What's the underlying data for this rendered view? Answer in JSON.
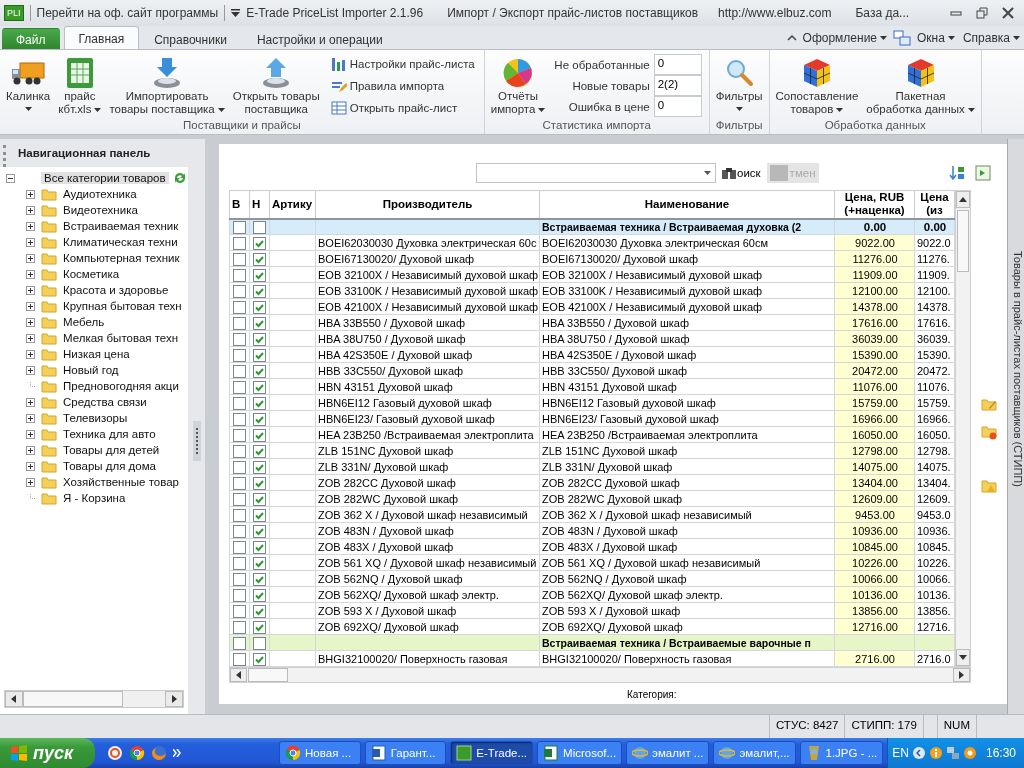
{
  "title_bar": {
    "app_badge": "PLI",
    "site_link": "Перейти на оф. сайт программы",
    "app_name": "E-Trade PriceList Importer 2.1.96",
    "subtitle": "Импорт / Экспорт прайс-листов поставщиков",
    "url": "http://www.elbuz.com",
    "database": "База да..."
  },
  "ribbon_tabs": [
    {
      "label": "Файл",
      "kind": "file",
      "selected": false
    },
    {
      "label": "Главная",
      "kind": "tab",
      "selected": true
    },
    {
      "label": "Справочники",
      "kind": "tab",
      "selected": false
    },
    {
      "label": "Настройки и операции",
      "kind": "tab",
      "selected": false
    }
  ],
  "ribbon_menus": [
    {
      "label": "Оформление"
    },
    {
      "label": "Окна"
    },
    {
      "label": "Справка"
    }
  ],
  "ribbon_groups": [
    {
      "title": "Поставщики и прайсы",
      "items": [
        {
          "kind": "large",
          "lines": [
            "Калинка"
          ],
          "dropdown": true
        },
        {
          "kind": "large",
          "lines": [
            "прайс",
            "кбт.xls"
          ],
          "dropdown": true
        },
        {
          "kind": "large",
          "lines": [
            "Импортировать",
            "товары поставщика"
          ],
          "dropdown": true
        },
        {
          "kind": "large",
          "lines": [
            "Открыть товары",
            "поставщика"
          ],
          "dropdown": false
        },
        {
          "kind": "small",
          "label": "Настройки прайс-листа"
        },
        {
          "kind": "small",
          "label": "Правила импорта"
        },
        {
          "kind": "small",
          "label": "Открыть прайс-лист"
        }
      ]
    },
    {
      "title": "Статистика импорта",
      "items": [
        {
          "kind": "large",
          "lines": [
            "Отчёты",
            "импорта"
          ],
          "dropdown": true
        },
        {
          "kind": "stat",
          "label": "Не обработанные",
          "value": "0"
        },
        {
          "kind": "stat",
          "label": "Новые товары",
          "value": "2(2)"
        },
        {
          "kind": "stat",
          "label": "Ошибка в цене",
          "value": "0"
        }
      ]
    },
    {
      "title": "Фильтры",
      "items": [
        {
          "kind": "large",
          "lines": [
            "Фильтры"
          ],
          "dropdown": true
        }
      ]
    },
    {
      "title": "Обработка данных",
      "items": [
        {
          "kind": "large",
          "lines": [
            "Сопоставление",
            "товаров"
          ],
          "dropdown": true
        },
        {
          "kind": "large",
          "lines": [
            "Пакетная",
            "обработка данных"
          ],
          "dropdown": true
        }
      ]
    }
  ],
  "nav_panel": {
    "title": "Навигационная панель",
    "tree": [
      {
        "label": "Все категории товаров",
        "kind": "folder",
        "expanded": true,
        "selected": true,
        "children": [
          {
            "label": "Аудиотехника",
            "kind": "folder",
            "expanded": false,
            "selected": false
          },
          {
            "label": "Видеотехника",
            "kind": "folder",
            "expanded": false,
            "selected": false
          },
          {
            "label": "Встраиваемая техник",
            "kind": "folder",
            "expanded": false,
            "selected": false
          },
          {
            "label": "Климатическая техни",
            "kind": "folder",
            "expanded": false,
            "selected": false
          },
          {
            "label": "Компьютерная техник",
            "kind": "folder",
            "expanded": false,
            "selected": false
          },
          {
            "label": "Косметика",
            "kind": "folder",
            "expanded": false,
            "selected": false
          },
          {
            "label": "Красота и здоровье",
            "kind": "folder",
            "expanded": false,
            "selected": false
          },
          {
            "label": "Крупная бытовая техн",
            "kind": "folder",
            "expanded": false,
            "selected": false
          },
          {
            "label": "Мебель",
            "kind": "folder",
            "expanded": false,
            "selected": false
          },
          {
            "label": "Мелкая бытовая техн",
            "kind": "folder",
            "expanded": false,
            "selected": false
          },
          {
            "label": "Низкая цена",
            "kind": "folder",
            "expanded": false,
            "selected": false
          },
          {
            "label": "Новый год",
            "kind": "folder",
            "expanded": false,
            "selected": false
          },
          {
            "label": "Предновогодняя акци",
            "kind": "leaf",
            "selected": false
          },
          {
            "label": "Средства связи",
            "kind": "folder",
            "expanded": false,
            "selected": false
          },
          {
            "label": "Телевизоры",
            "kind": "folder",
            "expanded": false,
            "selected": false
          },
          {
            "label": "Техника для авто",
            "kind": "folder",
            "expanded": false,
            "selected": false
          },
          {
            "label": "Товары для детей",
            "kind": "folder",
            "expanded": false,
            "selected": false
          },
          {
            "label": "Товары для дома",
            "kind": "folder",
            "expanded": false,
            "selected": false
          },
          {
            "label": "Хозяйственные товар",
            "kind": "folder",
            "expanded": false,
            "selected": false
          },
          {
            "label": "Я - Корзина",
            "kind": "leaf",
            "selected": false
          }
        ]
      }
    ]
  },
  "grid": {
    "search_button": "оиск",
    "cancel_button": {
      "label": "тмен",
      "disabled": true
    },
    "columns": [
      "В",
      "Н",
      "Артику",
      "Производитель",
      "Наименование",
      "Цена, RUB (+наценка)",
      "Цена (из"
    ],
    "rows": [
      {
        "kind": "group",
        "b": false,
        "h": false,
        "title": "Встраиваемая техника / Встраиваемая духовка (2",
        "price": "0.00",
        "price_src": "0.00",
        "color": "#d7ecfb"
      },
      {
        "kind": "item",
        "b": false,
        "h": true,
        "maker": "BOEI62030030 Духовка электрическая 60с",
        "name": "BOEI62030030 Духовка электрическая 60см",
        "price": "9022.00",
        "price_src": "9022.0"
      },
      {
        "kind": "item",
        "b": false,
        "h": true,
        "maker": "BOEI67130020/ Духовой шкаф",
        "name": "BOEI67130020/ Духовой шкаф",
        "price": "11276.00",
        "price_src": "11276."
      },
      {
        "kind": "item",
        "b": false,
        "h": true,
        "maker": "EOB 32100X / Независимый духовой шкаф",
        "name": "EOB 32100X / Независимый духовой шкаф",
        "price": "11909.00",
        "price_src": "11909."
      },
      {
        "kind": "item",
        "b": false,
        "h": true,
        "maker": "EOB 33100K / Независимый духовой шкаф",
        "name": "EOB 33100K / Независимый духовой шкаф",
        "price": "12100.00",
        "price_src": "12100."
      },
      {
        "kind": "item",
        "b": false,
        "h": true,
        "maker": "EOB 42100X / Независимый духовой шкаф",
        "name": "EOB 42100X / Независимый духовой шкаф",
        "price": "14378.00",
        "price_src": "14378."
      },
      {
        "kind": "item",
        "b": false,
        "h": true,
        "maker": "HBA 33B550 / Духовой шкаф",
        "name": "HBA 33B550 / Духовой шкаф",
        "price": "17616.00",
        "price_src": "17616."
      },
      {
        "kind": "item",
        "b": false,
        "h": true,
        "maker": "HBA 38U750 / Духовой шкаф",
        "name": "HBA 38U750 / Духовой шкаф",
        "price": "36039.00",
        "price_src": "36039."
      },
      {
        "kind": "item",
        "b": false,
        "h": true,
        "maker": "HBA 42S350E / Духовой шкаф",
        "name": "HBA 42S350E / Духовой шкаф",
        "price": "15390.00",
        "price_src": "15390."
      },
      {
        "kind": "item",
        "b": false,
        "h": true,
        "maker": "HBB 33C550/ Духовой шкаф",
        "name": "HBB 33C550/ Духовой шкаф",
        "price": "20472.00",
        "price_src": "20472."
      },
      {
        "kind": "item",
        "b": false,
        "h": true,
        "maker": "HBN 43151 Духовой шкаф",
        "name": "HBN 43151 Духовой шкаф",
        "price": "11076.00",
        "price_src": "11076."
      },
      {
        "kind": "item",
        "b": false,
        "h": true,
        "maker": "HBN6EI12 Газовый духовой шкаф",
        "name": "HBN6EI12 Газовый духовой шкаф",
        "price": "15759.00",
        "price_src": "15759."
      },
      {
        "kind": "item",
        "b": false,
        "h": true,
        "maker": "HBN6EI23/ Газовый духовой шкаф",
        "name": "HBN6EI23/ Газовый духовой шкаф",
        "price": "16966.00",
        "price_src": "16966."
      },
      {
        "kind": "item",
        "b": false,
        "h": true,
        "maker": "HEA 23B250 /Встраиваемая электроплита",
        "name": "HEA 23B250 /Встраиваемая электроплита",
        "price": "16050.00",
        "price_src": "16050."
      },
      {
        "kind": "item",
        "b": false,
        "h": true,
        "maker": "ZLB 151NC  Духовой шкаф",
        "name": "ZLB 151NC  Духовой шкаф",
        "price": "12798.00",
        "price_src": "12798."
      },
      {
        "kind": "item",
        "b": false,
        "h": true,
        "maker": "ZLB 331N/ Духовой шкаф",
        "name": "ZLB 331N/ Духовой шкаф",
        "price": "14075.00",
        "price_src": "14075."
      },
      {
        "kind": "item",
        "b": false,
        "h": true,
        "maker": "ZOB 282CC Духовой шкаф",
        "name": "ZOB 282CC Духовой шкаф",
        "price": "13404.00",
        "price_src": "13404."
      },
      {
        "kind": "item",
        "b": false,
        "h": true,
        "maker": "ZOB 282WC Духовой шкаф",
        "name": "ZOB 282WC Духовой шкаф",
        "price": "12609.00",
        "price_src": "12609."
      },
      {
        "kind": "item",
        "b": false,
        "h": true,
        "maker": "ZOB 362 X / Духовой шкаф независимый",
        "name": "ZOB 362 X / Духовой шкаф независимый",
        "price": "9453.00",
        "price_src": "9453.0"
      },
      {
        "kind": "item",
        "b": false,
        "h": true,
        "maker": "ZOB 483N / Духовой шкаф",
        "name": "ZOB 483N / Духовой шкаф",
        "price": "10936.00",
        "price_src": "10936."
      },
      {
        "kind": "item",
        "b": false,
        "h": true,
        "maker": "ZOB 483X / Духовой шкаф",
        "name": "ZOB 483X / Духовой шкаф",
        "price": "10845.00",
        "price_src": "10845."
      },
      {
        "kind": "item",
        "b": false,
        "h": true,
        "maker": "ZOB 561 XQ / Духовой шкаф независимый",
        "name": "ZOB 561 XQ / Духовой шкаф независимый",
        "price": "10226.00",
        "price_src": "10226."
      },
      {
        "kind": "item",
        "b": false,
        "h": true,
        "maker": "ZOB 562NQ / Духовой шкаф",
        "name": "ZOB 562NQ / Духовой шкаф",
        "price": "10066.00",
        "price_src": "10066."
      },
      {
        "kind": "item",
        "b": false,
        "h": true,
        "maker": "ZOB 562XQ/ Духовой шкаф электр.",
        "name": "ZOB 562XQ/ Духовой шкаф электр.",
        "price": "10136.00",
        "price_src": "10136."
      },
      {
        "kind": "item",
        "b": false,
        "h": true,
        "maker": "ZOB 593 X / Духовой шкаф",
        "name": "ZOB 593 X / Духовой шкаф",
        "price": "13856.00",
        "price_src": "13856."
      },
      {
        "kind": "item",
        "b": false,
        "h": true,
        "maker": "ZOB 692XQ/ Духовой шкаф",
        "name": "ZOB 692XQ/ Духовой шкаф",
        "price": "12716.00",
        "price_src": "12716."
      },
      {
        "kind": "group",
        "b": false,
        "h": false,
        "title": "Встраиваемая техника / Встраиваемые варочные п",
        "color": "#e6f6c9"
      },
      {
        "kind": "item",
        "b": false,
        "h": true,
        "maker": "BHGI32100020/ Поверхность газовая",
        "name": "BHGI32100020/ Поверхность газовая",
        "price": "2716.00",
        "price_src": "2716.0"
      }
    ],
    "footer": "Категория:"
  },
  "side_tab": "Товары в прайс-листах поставщиков (СТИПП)",
  "status_bar": [
    "СТУС: 8427",
    "СТИПП: 179",
    "NUM"
  ],
  "taskbar": {
    "start": "пуск",
    "tasks": [
      {
        "label": "Новая ...",
        "selected": false
      },
      {
        "label": "Гарант...",
        "selected": false
      },
      {
        "label": "E-Trade...",
        "selected": true
      },
      {
        "label": "Microsof...",
        "selected": false
      },
      {
        "label": "эмалит ...",
        "selected": false
      },
      {
        "label": "эмалит,...",
        "selected": false
      },
      {
        "label": "1.JPG - ...",
        "selected": false
      }
    ],
    "language": "EN",
    "clock": "16:30"
  }
}
